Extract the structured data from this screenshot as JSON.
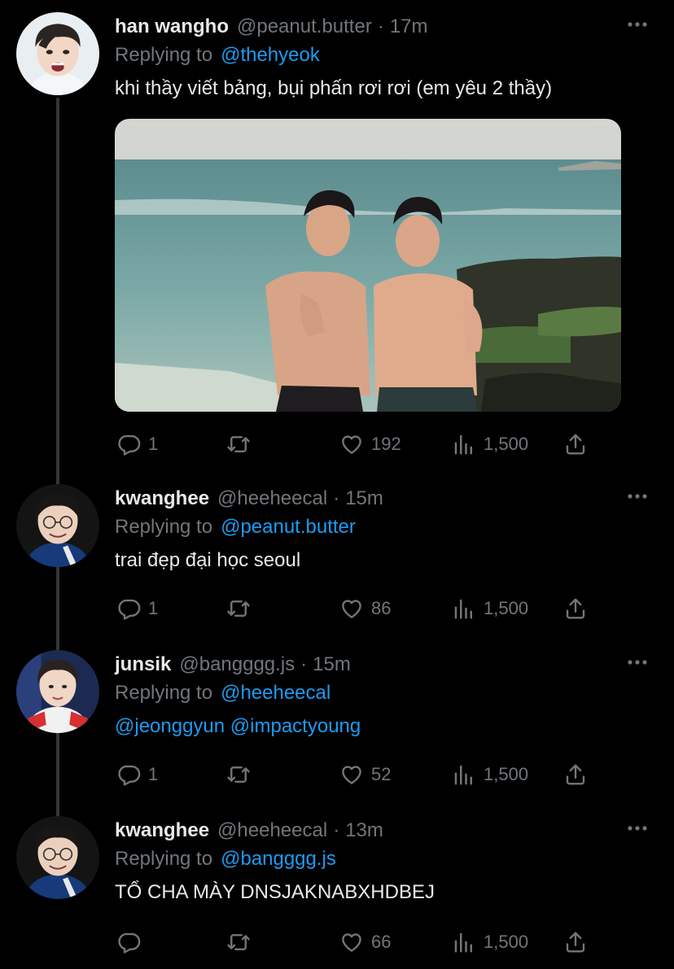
{
  "tweets": [
    {
      "display_name": "han wangho",
      "handle": "@peanut.butter",
      "separator": "·",
      "time": "17m",
      "replying_prefix": "Replying to",
      "replying_to": "@thehyeok",
      "text": "khi thầy viết bảng, bụi phấn rơi rơi (em yêu 2 thầy)",
      "replies": "1",
      "retweets": "",
      "likes": "192",
      "views": "1,500"
    },
    {
      "display_name": "kwanghee",
      "handle": "@heeheecal",
      "separator": "·",
      "time": "15m",
      "replying_prefix": "Replying to",
      "replying_to": "@peanut.butter",
      "text": "trai đẹp đại học seoul",
      "replies": "1",
      "retweets": "",
      "likes": "86",
      "views": "1,500"
    },
    {
      "display_name": "junsik",
      "handle": "@bangggg.js",
      "separator": "·",
      "time": "15m",
      "replying_prefix": "Replying to",
      "replying_to": "@heeheecal",
      "text": "@jeonggyun @impactyoung",
      "replies": "1",
      "retweets": "",
      "likes": "52",
      "views": "1,500"
    },
    {
      "display_name": "kwanghee",
      "handle": "@heeheecal",
      "separator": "·",
      "time": "13m",
      "replying_prefix": "Replying to",
      "replying_to": "@bangggg.js",
      "text": "TỔ CHA MÀY DNSJAKNABXHDBEJ",
      "replies": "",
      "retweets": "",
      "likes": "66",
      "views": "1,500"
    }
  ],
  "icons": {
    "reply": "reply-icon",
    "retweet": "retweet-icon",
    "like": "heart-icon",
    "views": "views-icon",
    "share": "share-icon",
    "more": "more-icon"
  },
  "colors": {
    "background": "#000000",
    "text": "#e7e9ea",
    "muted": "#71767b",
    "accent": "#1d9bf0",
    "thread_line": "#333639"
  }
}
